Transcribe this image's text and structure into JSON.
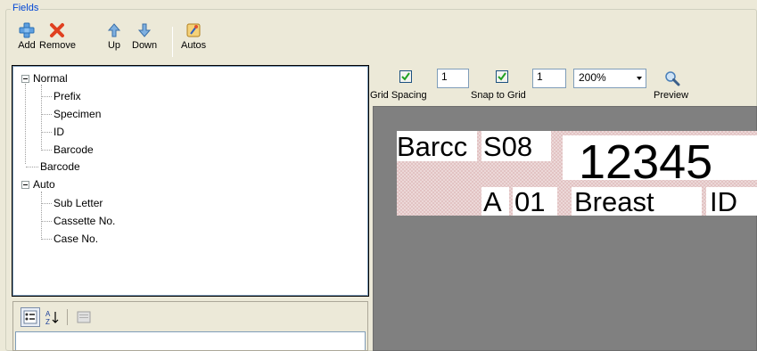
{
  "group": {
    "title": "Fields"
  },
  "toolbar": {
    "add_label": "Add",
    "remove_label": "Remove",
    "up_label": "Up",
    "down_label": "Down",
    "autos_label": "Autos"
  },
  "tree": {
    "normal": "Normal",
    "normal_children": [
      "Prefix",
      "Specimen",
      "ID",
      "Barcode"
    ],
    "barcode": "Barcode",
    "auto": "Auto",
    "auto_children": [
      "Sub Letter",
      "Cassette No.",
      "Case No."
    ]
  },
  "controls": {
    "grid_spacing_label": "Grid Spacing",
    "grid_spacing_value": "1",
    "grid_spacing_checked": true,
    "snap_to_grid_label": "Snap to Grid",
    "snap_to_grid_value": "1",
    "snap_to_grid_checked": true,
    "zoom_value": "200%",
    "preview_label": "Preview"
  },
  "label_fields": {
    "barcode": "Barcc",
    "specimen": "S08",
    "case_no": "12345",
    "prefix": "A",
    "cassette": "01",
    "sub": "Breast",
    "id": "ID"
  },
  "colors": {
    "accent": "#0046d5",
    "canvas": "#808080",
    "label_bg": "#e2c3c3"
  }
}
